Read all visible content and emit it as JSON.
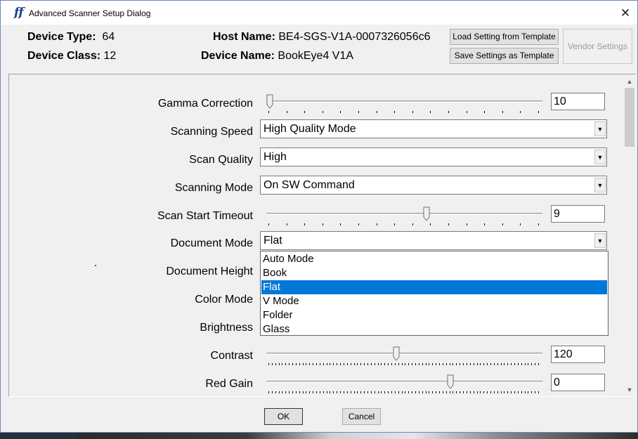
{
  "window": {
    "title": "Advanced Scanner Setup Dialog",
    "logo_text": "ff",
    "close_glyph": "✕"
  },
  "device": {
    "type_label": "Device Type:",
    "type_value": "64",
    "class_label": "Device Class:",
    "class_value": "12",
    "host_label": "Host Name:",
    "host_value": "BE4-SGS-V1A-0007326056c6",
    "name_label": "Device Name:",
    "name_value": "BookEye4 V1A"
  },
  "buttons": {
    "load_template": "Load Setting from Template",
    "save_template": "Save Settings as Template",
    "vendor": "Vendor Settings",
    "ok": "OK",
    "cancel": "Cancel"
  },
  "settings": {
    "gamma": {
      "label": "Gamma Correction",
      "value": "10",
      "level": 0.0
    },
    "speed": {
      "label": "Scanning Speed",
      "value": "High Quality Mode"
    },
    "quality": {
      "label": "Scan Quality",
      "value": "High"
    },
    "mode": {
      "label": "Scanning Mode",
      "value": "On SW Command"
    },
    "timeout": {
      "label": "Scan Start Timeout",
      "value": "9",
      "level": 0.58
    },
    "document_mode": {
      "label": "Document Mode",
      "value": "Flat",
      "options": [
        "Auto Mode",
        "Book",
        "Flat",
        "V Mode",
        "Folder",
        "Glass"
      ],
      "selected_index": 2
    },
    "doc_height": {
      "label": "Document Height"
    },
    "color_mode": {
      "label": "Color Mode"
    },
    "brightness": {
      "label": "Brightness"
    },
    "contrast": {
      "label": "Contrast",
      "value": "120",
      "level": 0.47
    },
    "red_gain": {
      "label": "Red Gain",
      "value": "0",
      "level": 0.67
    }
  },
  "icons": {
    "combo_arrow": "chevron-down-icon",
    "scroll_up": "chevron-up-icon",
    "scroll_down": "chevron-down-icon"
  },
  "colors": {
    "selection": "#0078d7",
    "logo": "#1b3f8f"
  }
}
